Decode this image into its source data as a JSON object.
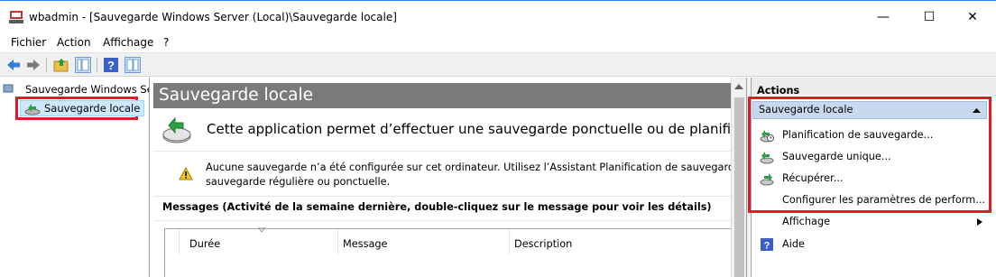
{
  "window": {
    "title": "wbadmin - [Sauvegarde Windows Server (Local)\\Sauvegarde locale]",
    "minimize_glyph": "—",
    "maximize_glyph": "☐",
    "close_glyph": "✕"
  },
  "menu": {
    "items": [
      "Fichier",
      "Action",
      "Affichage",
      "?"
    ]
  },
  "toolbar": {
    "buttons": [
      "back-arrow-icon",
      "forward-arrow-icon",
      "up-folder-icon",
      "show-hide-tree-icon",
      "help-icon",
      "show-hide-action-pane-icon"
    ]
  },
  "tree": {
    "root_label": "Sauvegarde Windows Server (Local)",
    "child_label": "Sauvegarde locale"
  },
  "center": {
    "header": "Sauvegarde locale",
    "hero_text": "Cette application permet d’effectuer une sauvegarde ponctuelle ou de planifier une sauvegarde régulière.",
    "warning_line1": "Aucune sauvegarde n’a été configurée sur cet ordinateur. Utilisez l’Assistant Planification de sauvegarde ou l’Assistant Sauvegarde unique pour effectuer une",
    "warning_line2": "sauvegarde régulière ou ponctuelle.",
    "messages_title": "Messages (Activité de la semaine dernière, double-cliquez sur le message pour voir les détails)",
    "columns": [
      "Durée",
      "Message",
      "Description"
    ]
  },
  "actions": {
    "header": "Actions",
    "group_title": "Sauvegarde locale",
    "items": [
      "Planification de sauvegarde...",
      "Sauvegarde unique...",
      "Récupérer...",
      "Configurer les paramètres de perform...",
      "Affichage",
      "Aide"
    ]
  },
  "colors": {
    "highlight_red": "#e0192b",
    "selection_blue": "#cce8ff",
    "header_gray": "#7a7a7a",
    "group_header_blue": "#c8d9ef"
  }
}
